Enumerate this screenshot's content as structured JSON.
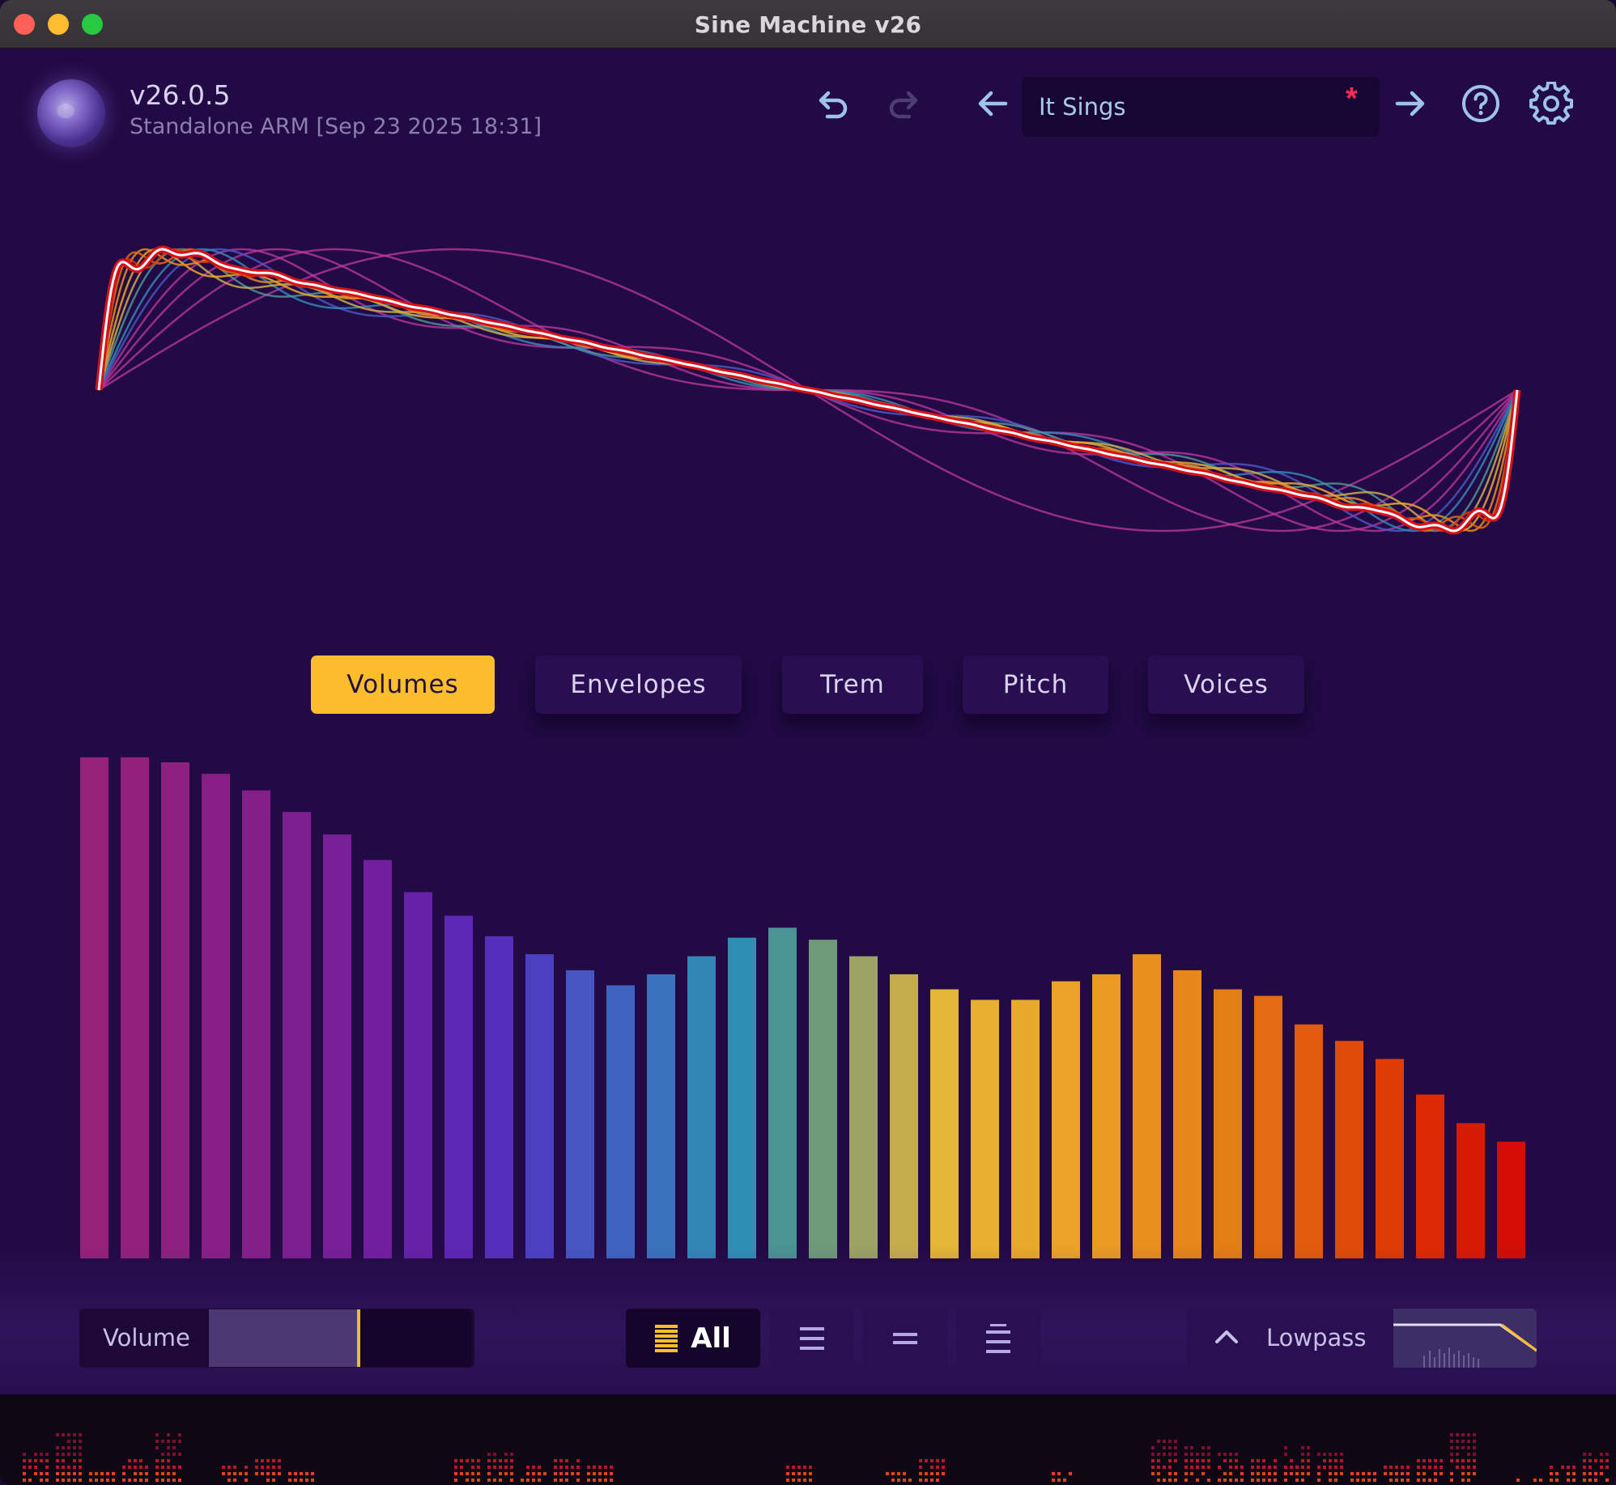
{
  "window": {
    "title": "Sine Machine v26",
    "traffic_lights": [
      "close",
      "minimize",
      "maximize"
    ]
  },
  "header": {
    "version": "v26.0.5",
    "build": "Standalone ARM [Sep 23 2025 18:31]",
    "undo_icon": "undo-icon",
    "redo_icon": "redo-icon",
    "prev_preset_icon": "arrow-left-icon",
    "next_preset_icon": "arrow-right-icon",
    "help_icon": "help-icon",
    "settings_icon": "gear-icon",
    "preset": {
      "name": "It Sings",
      "modified_marker": "*"
    }
  },
  "tabs": [
    {
      "label": "Volumes",
      "active": true
    },
    {
      "label": "Envelopes",
      "active": false
    },
    {
      "label": "Trem",
      "active": false
    },
    {
      "label": "Pitch",
      "active": false
    },
    {
      "label": "Voices",
      "active": false
    }
  ],
  "harmonic_volumes": {
    "count": 36,
    "levels": [
      1.0,
      1.0,
      0.99,
      0.967,
      0.934,
      0.891,
      0.846,
      0.795,
      0.731,
      0.684,
      0.643,
      0.607,
      0.575,
      0.545,
      0.567,
      0.603,
      0.64,
      0.66,
      0.636,
      0.603,
      0.567,
      0.537,
      0.516,
      0.516,
      0.553,
      0.567,
      0.607,
      0.575,
      0.537,
      0.524,
      0.467,
      0.434,
      0.398,
      0.327,
      0.27,
      0.233
    ],
    "colors": [
      "#962178",
      "#93207d",
      "#8e2081",
      "#891f86",
      "#841f8a",
      "#7e1f90",
      "#781f97",
      "#711f9f",
      "#6621a7",
      "#5d28b3",
      "#5530bd",
      "#4c40c2",
      "#4756c2",
      "#3f64c0",
      "#3a73bb",
      "#3286b5",
      "#2f8fb2",
      "#4a9493",
      "#6f9a7a",
      "#9ca364",
      "#c5ac4d",
      "#e3b637",
      "#e8b02e",
      "#e9a92b",
      "#eca229",
      "#ea9b24",
      "#e98f1e",
      "#e78719",
      "#e57d15",
      "#e46b11",
      "#e25b0c",
      "#e04c07",
      "#df3b04",
      "#dd2a03",
      "#d71a03",
      "#d30d04"
    ],
    "base_waveform_color": "#c03aa0"
  },
  "bottom_bar": {
    "volume": {
      "label": "Volume",
      "level": 0.57
    },
    "harmonic_filter": {
      "selected": "All",
      "options": [
        {
          "label": "All",
          "icon": "all-harmonics-icon"
        },
        {
          "label": "",
          "icon": "odd-harmonics-icon"
        },
        {
          "label": "",
          "icon": "even-harmonics-icon"
        },
        {
          "label": "",
          "icon": "harmonic-group-icon"
        }
      ]
    },
    "filter": {
      "label": "Lowpass",
      "expand_icon": "chevron-up-icon"
    }
  },
  "colors": {
    "background": "#220a45",
    "accent": "#fbbd2b",
    "preset_text": "#a9c9ee",
    "modified_marker": "#ff2a55",
    "icon": "#9fc2ec"
  }
}
